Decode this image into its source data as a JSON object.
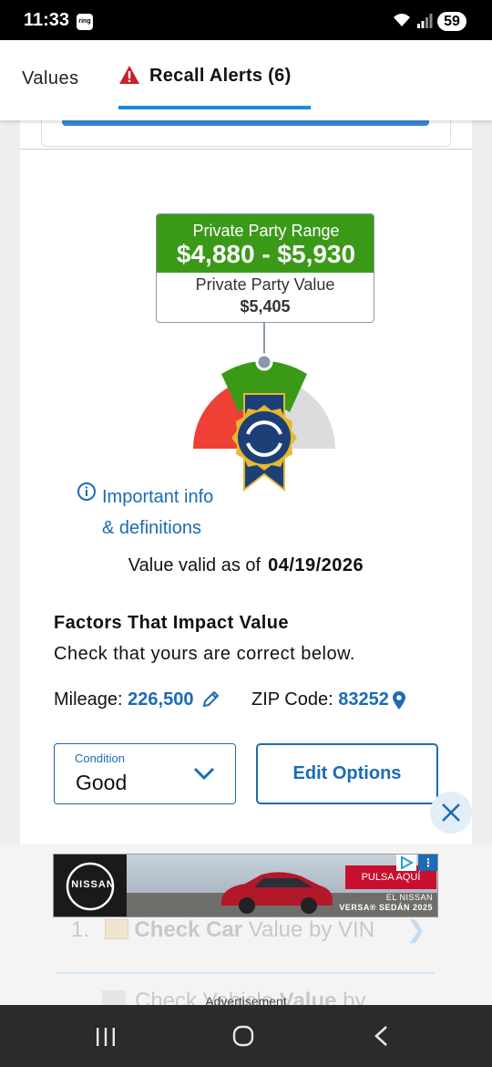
{
  "status_bar": {
    "time": "11:33",
    "ring_label": "ring",
    "battery": "59"
  },
  "tabs": {
    "values_label": "Values",
    "recall_label": "Recall Alerts (6)"
  },
  "valuation": {
    "range_label": "Private Party Range",
    "range_value": "$4,880 - $5,930",
    "value_label": "Private Party Value",
    "value_amount": "$5,405"
  },
  "info": {
    "line1": "Important info",
    "line2": "& definitions"
  },
  "validity": {
    "label": "Value valid as of",
    "date": "04/19/2026"
  },
  "factors": {
    "title": "Factors That Impact Value",
    "subtitle": "Check that yours are correct below.",
    "mileage_label": "Mileage:",
    "mileage_value": "226,500",
    "zip_label": "ZIP Code:",
    "zip_value": "83252"
  },
  "condition": {
    "label": "Condition",
    "value": "Good"
  },
  "edit_options_label": "Edit Options",
  "behind_ad": {
    "item_number": "1.",
    "item_bold": "Check Car",
    "item_rest": " Value by VIN",
    "next_line_start": "Check Vehicle ",
    "next_line_bold": "Value",
    "next_line_end": " by"
  },
  "ad": {
    "brand": "NISSAN",
    "cta": "PULSA AQUÍ",
    "line1": "EL NISSAN",
    "line2": "VERSA® SEDÁN 2025",
    "label": "Advertisement"
  },
  "colors": {
    "accent_blue": "#1b6bb5",
    "tab_underline": "#1a8ae0",
    "range_green": "#3a9a18",
    "gauge_red": "#ee4035",
    "gauge_gray": "#dcdcdc",
    "ribbon_navy": "#1d3f78",
    "ribbon_gold": "#e6b82e"
  },
  "icons": {
    "warning": "warning-triangle-icon",
    "info": "info-circle-icon",
    "pencil": "pencil-icon",
    "pin": "map-pin-icon",
    "chevron": "chevron-down-icon",
    "close": "close-icon"
  }
}
